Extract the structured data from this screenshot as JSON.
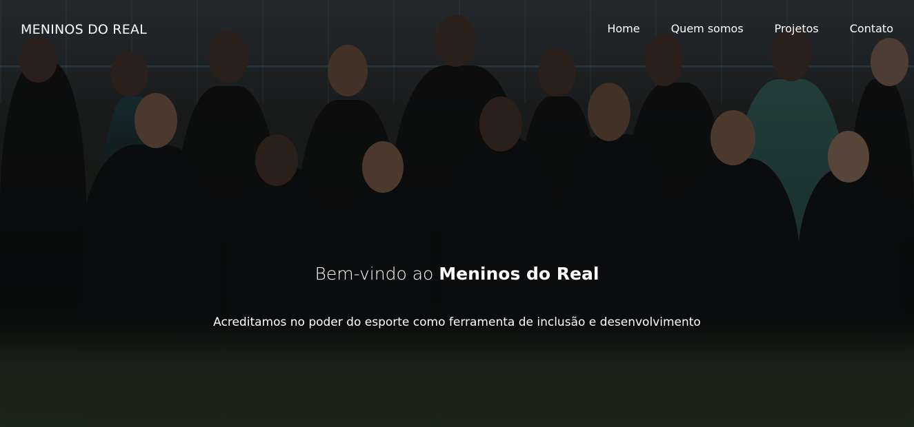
{
  "header": {
    "brand": "MENINOS DO REAL",
    "nav": [
      {
        "label": "Home"
      },
      {
        "label": "Quem somos"
      },
      {
        "label": "Projetos"
      },
      {
        "label": "Contato"
      }
    ]
  },
  "hero": {
    "title_prefix": "Bem-vindo ao",
    "title_emphasis": "Meninos do Real",
    "subtitle": "Acreditamos no poder do esporte como ferramenta de inclusão e desenvolvimento",
    "background": "team-photo"
  },
  "colors": {
    "text": "#ffffff",
    "overlay": "#000000"
  }
}
